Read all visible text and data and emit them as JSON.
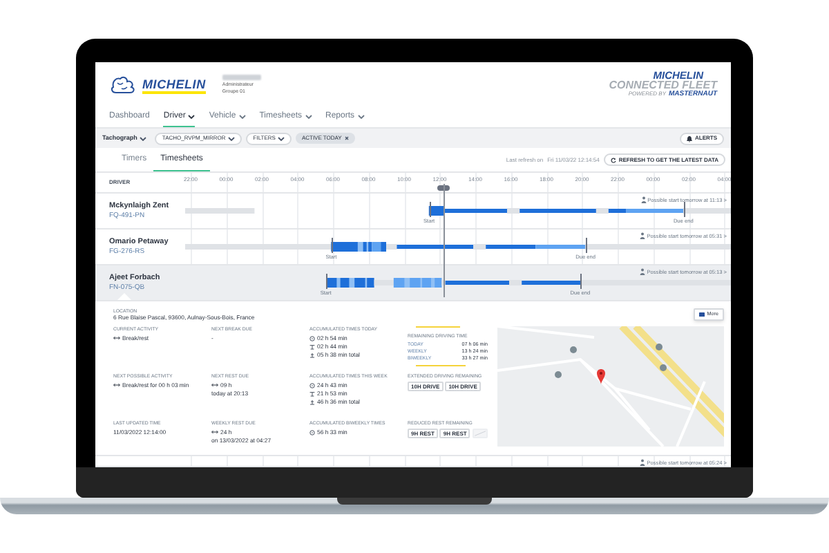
{
  "header": {
    "logo_text": "MICHELIN",
    "admin_role": "Administrateur",
    "admin_group": "Groupe 01",
    "fleet_logo": {
      "brand": "MICHELIN",
      "product": "CONNECTED FLEET",
      "powered_by": "POWERED BY",
      "partner": "MASTERNAUT"
    }
  },
  "nav": [
    {
      "label": "Dashboard",
      "selected": false,
      "dropdown": false
    },
    {
      "label": "Driver",
      "selected": true,
      "dropdown": true
    },
    {
      "label": "Vehicle",
      "selected": false,
      "dropdown": true
    },
    {
      "label": "Timesheets",
      "selected": false,
      "dropdown": true
    },
    {
      "label": "Reports",
      "selected": false,
      "dropdown": true
    }
  ],
  "filter_bar": {
    "mode": "Tachograph",
    "group": "TACHO_RVPM_MIRROR",
    "filters": "FILTERS",
    "active_chip": "ACTIVE TODAY",
    "alerts": "ALERTS"
  },
  "view_tabs": [
    {
      "label": "Timers",
      "selected": false
    },
    {
      "label": "Timesheets",
      "selected": true
    }
  ],
  "refresh": {
    "label": "Last refresh on",
    "time": "Fri 11/03/22 12:14:54",
    "button": "REFRESH TO GET THE LATEST DATA"
  },
  "timeline": {
    "driver_column": "DRIVER",
    "hours": [
      "22:00",
      "00:00",
      "02:00",
      "04:00",
      "06:00",
      "08:00",
      "10:00",
      "12:00",
      "14:00",
      "16:00",
      "18:00",
      "20:00",
      "22:00",
      "00:00",
      "02:00",
      "04:00"
    ],
    "drivers": [
      {
        "name": "Mckynlaigh Zent",
        "plate": "FQ-491-PN",
        "selected": false,
        "start_label": "Start",
        "end_label": "Due end",
        "possible_start": "Possible start tomorrow at 11:13 >"
      },
      {
        "name": "Omario Petaway",
        "plate": "FG-276-RS",
        "selected": false,
        "start_label": "Start",
        "end_label": "Due end",
        "possible_start": "Possible start tomorrow at 05:31 >"
      },
      {
        "name": "Ajeet Forbach",
        "plate": "FN-075-QB",
        "selected": true,
        "start_label": "Start",
        "end_label": "Due end",
        "possible_start": "Possible start tomorrow at 05:13 >"
      },
      {
        "possible_start": "Possible start tomorrow at 05:24 >"
      }
    ]
  },
  "details": {
    "location_label": "LOCATION",
    "location": "6 Rue Blaise Pascal, 93600, Aulnay-Sous-Bois, France",
    "more_button": "More",
    "fields": [
      {
        "kind": "activity",
        "label": "CURRENT ACTIVITY",
        "lines": [
          "Break/rest"
        ]
      },
      {
        "kind": "plain",
        "label": "NEXT BREAK DUE",
        "lines": [
          "-"
        ]
      },
      {
        "kind": "totals",
        "label": "ACCUMULATED TIMES TODAY",
        "lines": [
          "02 h 54 min",
          "02 h 44 min",
          "05 h 38 min total"
        ]
      },
      {
        "kind": "remaining",
        "label": "REMAINING DRIVING TIME",
        "rows": [
          {
            "period": "TODAY",
            "value": "07 h 06 min"
          },
          {
            "period": "WEEKLY",
            "value": "13 h 24 min"
          },
          {
            "period": "BIWEEKLY",
            "value": "33 h 27 min"
          }
        ]
      },
      {
        "kind": "activity",
        "label": "NEXT POSSIBLE ACTIVITY",
        "lines": [
          "Break/rest for 00 h 03 min"
        ]
      },
      {
        "kind": "activity",
        "label": "NEXT REST DUE",
        "lines": [
          "09 h",
          "today at 20:13"
        ]
      },
      {
        "kind": "totals",
        "label": "ACCUMULATED TIMES THIS WEEK",
        "lines": [
          "24 h 43 min",
          "21 h 53 min",
          "46 h 36 min total"
        ]
      },
      {
        "kind": "chips",
        "label": "EXTENDED DRIVING REMAINING",
        "chips": [
          {
            "label": "10H DRIVE",
            "used": false
          },
          {
            "label": "10H DRIVE",
            "used": false
          }
        ]
      },
      {
        "kind": "plain",
        "label": "LAST UPDATED TIME",
        "lines": [
          "11/03/2022 12:14:00"
        ]
      },
      {
        "kind": "activity",
        "label": "WEEKLY REST DUE",
        "lines": [
          "24 h",
          "on 13/03/2022 at 04:27"
        ]
      },
      {
        "kind": "totals",
        "label": "ACCUMULATED BIWEEKLY TIMES",
        "lines": [
          "56 h 33 min"
        ]
      },
      {
        "kind": "chips",
        "label": "REDUCED REST REMAINING",
        "chips": [
          {
            "label": "9H REST",
            "used": false
          },
          {
            "label": "9H REST",
            "used": false
          },
          {
            "used": true
          }
        ]
      }
    ]
  }
}
